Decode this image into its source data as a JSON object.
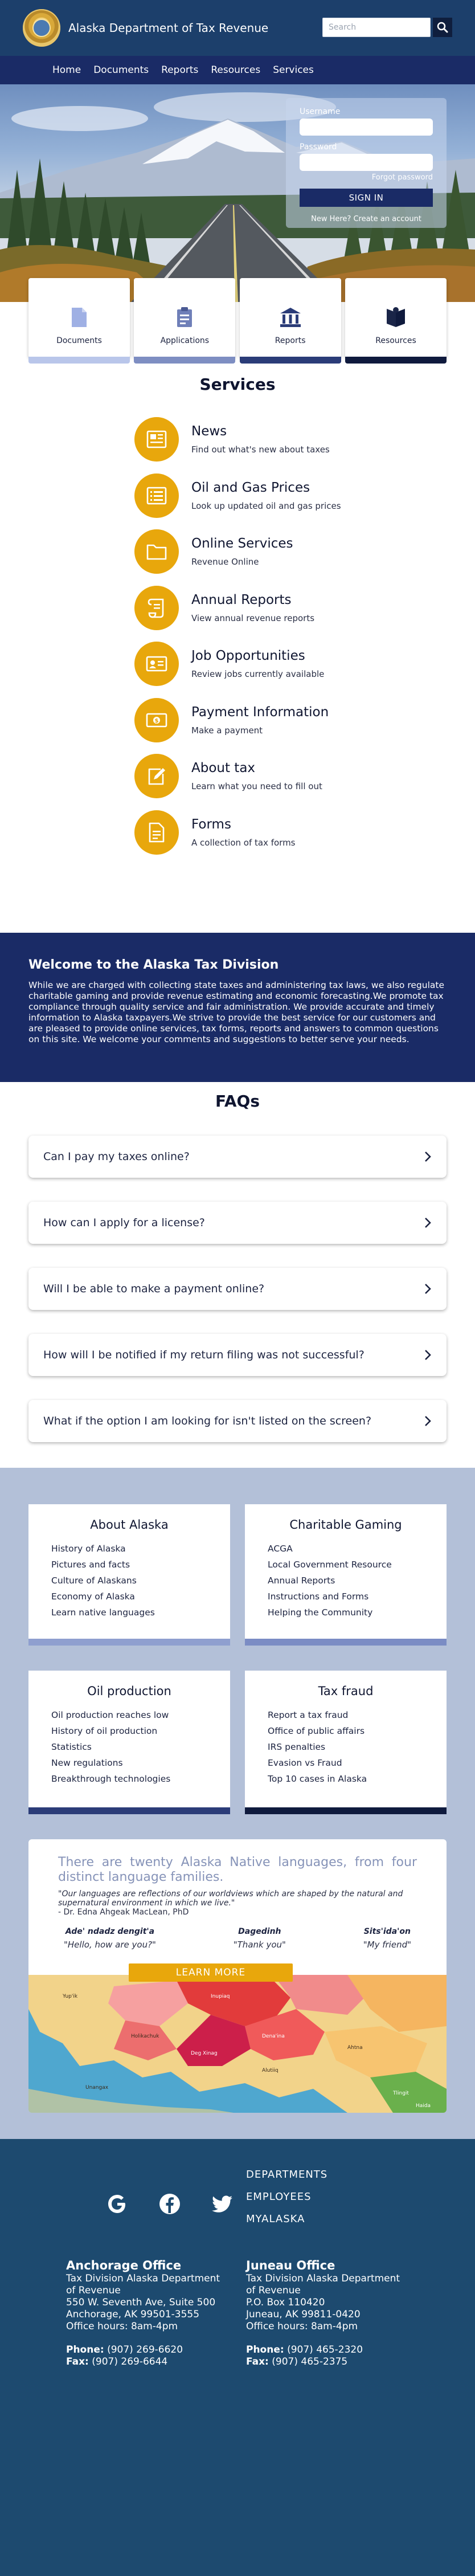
{
  "header": {
    "site_title": "Alaska Department of Tax Revenue",
    "search_placeholder": "Search"
  },
  "nav": {
    "items": [
      "Home",
      "Documents",
      "Reports",
      "Resources",
      "Services"
    ]
  },
  "login": {
    "username_label": "Username",
    "password_label": "Password",
    "forgot_label": "Forgot password",
    "signin_label": "SIGN IN",
    "new_here_label": "New Here? Create an account"
  },
  "quick_links": [
    {
      "label": "Documents",
      "icon": "document-icon",
      "bar_color": "#b9c6ea"
    },
    {
      "label": "Applications",
      "icon": "clipboard-icon",
      "bar_color": "#7e8ec2"
    },
    {
      "label": "Reports",
      "icon": "bank-icon",
      "bar_color": "#2b3c78"
    },
    {
      "label": "Resources",
      "icon": "books-icon",
      "bar_color": "#0f1a3d"
    }
  ],
  "services": {
    "title": "Services",
    "items": [
      {
        "title": "News",
        "desc": "Find out what's new about taxes",
        "icon": "newspaper-icon"
      },
      {
        "title": "Oil and Gas Prices",
        "desc": "Look up updated oil and gas prices",
        "icon": "list-icon"
      },
      {
        "title": "Online Services",
        "desc": "Revenue Online",
        "icon": "folder-icon"
      },
      {
        "title": "Annual Reports",
        "desc": "View annual revenue reports",
        "icon": "scroll-icon"
      },
      {
        "title": "Job Opportunities",
        "desc": "Review jobs currently available",
        "icon": "id-card-icon"
      },
      {
        "title": "Payment Information",
        "desc": "Make a payment",
        "icon": "money-icon"
      },
      {
        "title": "About tax",
        "desc": "Learn what you need to fill out",
        "icon": "edit-icon"
      },
      {
        "title": "Forms",
        "desc": "A collection of tax forms",
        "icon": "form-icon"
      }
    ]
  },
  "welcome": {
    "title": "Welcome to the Alaska Tax Division",
    "body": "While we are charged with collecting state taxes and administering tax laws, we also regulate charitable gaming and provide revenue estimating and economic forecasting.We promote tax compliance through quality service and fair administration. We provide accurate and timely information to Alaska taxpayers.We strive to provide the best service for our customers and are pleased to provide online services, tax forms, reports and answers to common questions on this site. We welcome your comments and suggestions to better serve your needs."
  },
  "faqs": {
    "title": "FAQs",
    "items": [
      "Can I pay my taxes online?",
      "How can I apply for a license?",
      "Will I be able to make a payment online?",
      "How will I be notified if my return filing was not successful?",
      "What if the option I am looking for isn't listed on the screen?"
    ]
  },
  "resources": {
    "cards": [
      {
        "title": "About Alaska",
        "bar_color": "#8f9fcf",
        "items": [
          "History of Alaska",
          "Pictures and facts",
          "Culture of Alaskans",
          "Economy of Alaska",
          "Learn native languages"
        ]
      },
      {
        "title": "Charitable Gaming",
        "bar_color": "#7b8cc4",
        "items": [
          "ACGA",
          "Local Government Resource",
          "Annual Reports",
          "Instructions and Forms",
          "Helping the Community"
        ]
      },
      {
        "title": "Oil production",
        "bar_color": "#2b3c78",
        "items": [
          "Oil production reaches low",
          "History of oil production",
          "Statistics",
          "New regulations",
          "Breakthrough technologies"
        ]
      },
      {
        "title": "Tax fraud",
        "bar_color": "#0f1a3d",
        "items": [
          "Report a tax fraud",
          "Office of public affairs",
          "IRS penalties",
          "Evasion vs Fraud",
          "Top 10 cases in Alaska"
        ]
      }
    ]
  },
  "languages": {
    "headline": "There are twenty Alaska Native languages, from four distinct language families.",
    "quote": "\"Our languages are reflections of our worldviews which are shaped by the natural and supernatural environment in which we live.\"",
    "cite": "- Dr. Edna Ahgeak MacLean, PhD",
    "phrases": [
      {
        "native": "Ade' ndadz dengit'a",
        "english": "\"Hello, how are you?\""
      },
      {
        "native": "Dagedinh",
        "english": "\"Thank you\""
      },
      {
        "native": "Sits'ida'on",
        "english": "\"My friend\""
      }
    ],
    "learn_more": "LEARN MORE",
    "map_labels": [
      "Yup'ik",
      "Inupiaq",
      "Holikachuk",
      "Deg Xinag",
      "Alutiiq",
      "Unangax",
      "Dena'ina",
      "Ahtna",
      "Tlingit",
      "Haida"
    ]
  },
  "footer": {
    "links": [
      "DEPARTMENTS",
      "EMPLOYEES",
      "MYALASKA"
    ],
    "social_icons": [
      "google-icon",
      "facebook-icon",
      "twitter-icon"
    ],
    "offices": [
      {
        "name": "Anchorage Office",
        "dept": "Tax Division Alaska Department of Revenue",
        "address1": "550 W. Seventh Ave, Suite 500",
        "address2": "Anchorage, AK 99501-3555",
        "hours": "Office hours: 8am-4pm",
        "phone_label": "Phone:",
        "phone": "(907) 269-6620",
        "fax_label": "Fax:",
        "fax": "(907) 269-6644"
      },
      {
        "name": "Juneau Office",
        "dept": "Tax Division Alaska Department of Revenue",
        "address1": "P.O. Box 110420",
        "address2": "Juneau, AK 99811-0420",
        "hours": "Office hours: 8am-4pm",
        "phone_label": "Phone:",
        "phone": "(907) 465-2320",
        "fax_label": "Fax:",
        "fax": "(907) 465-2375"
      }
    ]
  }
}
